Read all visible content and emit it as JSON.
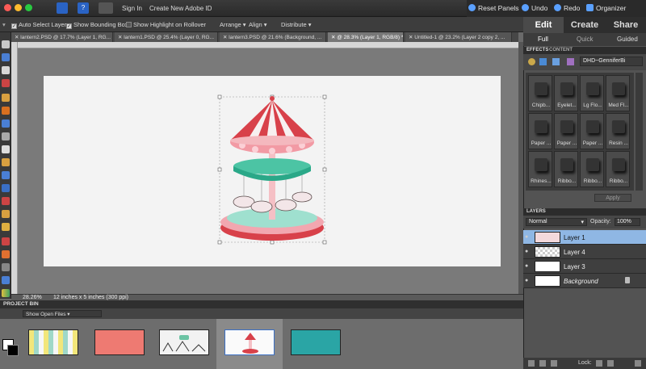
{
  "menubar": {
    "sign_in": "Sign In",
    "create_id": "Create New Adobe ID"
  },
  "topright": {
    "reset": "Reset Panels",
    "undo": "Undo",
    "redo": "Redo",
    "organizer": "Organizer"
  },
  "options": {
    "auto_select": "Auto Select Layer",
    "show_bbox": "Show Bounding Box",
    "show_highlight": "Show Highlight on Rollover",
    "arrange": "Arrange",
    "align": "Align",
    "distribute": "Distribute"
  },
  "doc_tabs": [
    {
      "label": "lantern2.PSD @ 17.7% (Layer 1, RG..."
    },
    {
      "label": "lantern1.PSD @ 25.4% (Layer 0, RG..."
    },
    {
      "label": "lantern3.PSD @ 21.6% (Background, ..."
    },
    {
      "label": "@ 28.3% (Layer 1, RGB/8) *"
    },
    {
      "label": "Untitled-1 @ 23.2% (Layer 2 copy 2, ..."
    }
  ],
  "status": {
    "zoom": "28.26%",
    "doc_size": "12 inches x 5 inches (300 ppi)"
  },
  "bin": {
    "title": "PROJECT BIN",
    "selector": "Show Open Files"
  },
  "mode_tabs": {
    "edit": "Edit",
    "create": "Create",
    "share": "Share"
  },
  "sub_tabs": {
    "full": "Full",
    "quick": "Quick",
    "guided": "Guided"
  },
  "effects": {
    "tab1": "EFFECTS",
    "tab2": "CONTENT",
    "dropdown": "DHD~GenniferBi",
    "items": [
      "Chipb...",
      "Eyelet...",
      "Lg Flo...",
      "Med Fl...",
      "Paper ...",
      "Paper ...",
      "Paper ...",
      "Resin ...",
      "Rhines...",
      "Ribbo...",
      "Ribbo...",
      "Ribbo..."
    ],
    "apply": "Apply"
  },
  "layers": {
    "title": "LAYERS",
    "blend": "Normal",
    "opacity_label": "Opacity:",
    "opacity": "100%",
    "rows": [
      {
        "name": "Layer 1"
      },
      {
        "name": "Layer 4"
      },
      {
        "name": "Layer 3"
      },
      {
        "name": "Background"
      }
    ],
    "lock_label": "Lock:"
  },
  "colors": {
    "carousel_red": "#d8414a",
    "carousel_pink": "#f2a7b0",
    "carousel_mint": "#8fd9c4",
    "selected_layer": "#8fb7e4"
  }
}
